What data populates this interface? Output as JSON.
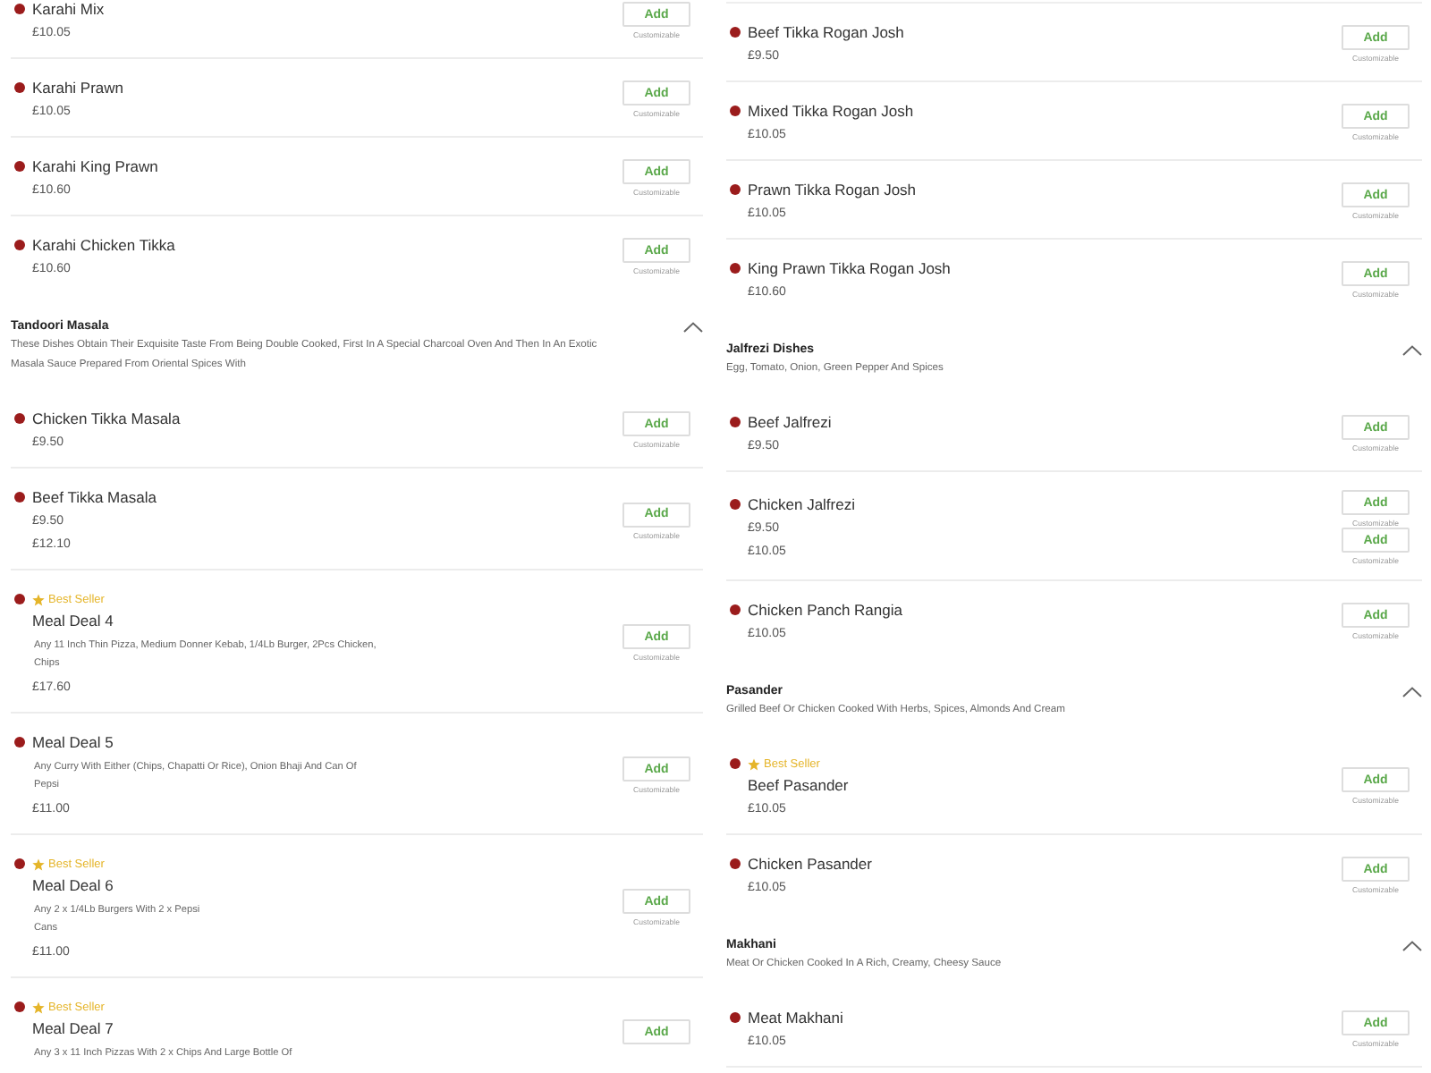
{
  "columns": [
    {
      "entries": [
        {
          "kind": "item",
          "name": "Karahi Mix",
          "prices": [
            "£10.05"
          ],
          "buttons": [
            {
              "label": "Add",
              "note": "Customizable"
            }
          ]
        },
        {
          "kind": "item",
          "name": "Karahi Prawn",
          "prices": [
            "£10.05"
          ],
          "buttons": [
            {
              "label": "Add",
              "note": "Customizable"
            }
          ]
        },
        {
          "kind": "item",
          "name": "Karahi King Prawn",
          "prices": [
            "£10.60"
          ],
          "buttons": [
            {
              "label": "Add",
              "note": "Customizable"
            }
          ]
        },
        {
          "kind": "item",
          "name": "Karahi Chicken Tikka",
          "prices": [
            "£10.60"
          ],
          "buttons": [
            {
              "label": "Add",
              "note": "Customizable"
            }
          ]
        },
        {
          "kind": "section",
          "title": "Tandoori Masala",
          "description": [
            "These Dishes Obtain Their Exquisite Taste From Being Double Cooked, First In A Special Charcoal Oven And Then In An Exotic",
            "Masala Sauce Prepared From Oriental Spices With"
          ],
          "expanded": true
        },
        {
          "kind": "item",
          "name": "Chicken Tikka Masala",
          "prices": [
            "£9.50"
          ],
          "buttons": [
            {
              "label": "Add",
              "note": "Customizable"
            }
          ]
        },
        {
          "kind": "item",
          "name": "Beef Tikka Masala",
          "prices": [
            "£9.50",
            "£12.10"
          ],
          "buttons": [
            {
              "label": "Add",
              "note": "Customizable"
            }
          ]
        },
        {
          "kind": "item",
          "badge": "Best Seller",
          "name": "Meal Deal 4",
          "description": [
            "Any 11 Inch Thin Pizza, Medium Donner Kebab, 1/4Lb Burger, 2Pcs Chicken,",
            "Chips"
          ],
          "prices": [
            "£17.60"
          ],
          "buttons": [
            {
              "label": "Add",
              "note": "Customizable"
            }
          ]
        },
        {
          "kind": "item",
          "name": "Meal Deal 5",
          "description": [
            "Any Curry With Either (Chips, Chapatti Or Rice), Onion Bhaji And Can Of",
            "Pepsi"
          ],
          "prices": [
            "£11.00"
          ],
          "buttons": [
            {
              "label": "Add",
              "note": "Customizable"
            }
          ]
        },
        {
          "kind": "item",
          "badge": "Best Seller",
          "name": "Meal Deal 6",
          "description": [
            "Any 2 x 1/4Lb Burgers With 2 x Pepsi",
            "Cans"
          ],
          "prices": [
            "£11.00"
          ],
          "buttons": [
            {
              "label": "Add",
              "note": "Customizable"
            }
          ]
        },
        {
          "kind": "item",
          "badge": "Best Seller",
          "name": "Meal Deal 7",
          "description": [
            "Any 3 x 11 Inch Pizzas With 2 x Chips And Large Bottle Of"
          ],
          "buttons": [
            {
              "label": "Add"
            }
          ]
        }
      ]
    },
    {
      "entries": [
        {
          "kind": "item",
          "name": "Beef Tikka Rogan Josh",
          "prices": [
            "£9.50"
          ],
          "buttons": [
            {
              "label": "Add",
              "note": "Customizable"
            }
          ]
        },
        {
          "kind": "item",
          "name": "Mixed Tikka Rogan Josh",
          "prices": [
            "£10.05"
          ],
          "buttons": [
            {
              "label": "Add",
              "note": "Customizable"
            }
          ]
        },
        {
          "kind": "item",
          "name": "Prawn Tikka Rogan Josh",
          "prices": [
            "£10.05"
          ],
          "buttons": [
            {
              "label": "Add",
              "note": "Customizable"
            }
          ]
        },
        {
          "kind": "item",
          "name": "King Prawn Tikka Rogan Josh",
          "prices": [
            "£10.60"
          ],
          "buttons": [
            {
              "label": "Add",
              "note": "Customizable"
            }
          ]
        },
        {
          "kind": "section",
          "title": "Jalfrezi Dishes",
          "description": [
            "Egg, Tomato, Onion, Green Pepper And Spices"
          ],
          "expanded": true
        },
        {
          "kind": "item",
          "name": "Beef Jalfrezi",
          "prices": [
            "£9.50"
          ],
          "buttons": [
            {
              "label": "Add",
              "note": "Customizable"
            }
          ]
        },
        {
          "kind": "item",
          "name": "Chicken Jalfrezi",
          "prices": [
            "£9.50",
            "£10.05"
          ],
          "buttons": [
            {
              "label": "Add",
              "note": "Customizable"
            },
            {
              "label": "Add",
              "note": "Customizable"
            }
          ]
        },
        {
          "kind": "item",
          "name": "Chicken Panch Rangia",
          "prices": [
            "£10.05"
          ],
          "buttons": [
            {
              "label": "Add",
              "note": "Customizable"
            }
          ]
        },
        {
          "kind": "section",
          "title": "Pasander",
          "description": [
            "Grilled Beef Or Chicken Cooked With Herbs, Spices, Almonds And Cream"
          ],
          "expanded": true
        },
        {
          "kind": "item",
          "badge": "Best Seller",
          "name": "Beef Pasander",
          "prices": [
            "£10.05"
          ],
          "buttons": [
            {
              "label": "Add",
              "note": "Customizable"
            }
          ]
        },
        {
          "kind": "item",
          "name": "Chicken Pasander",
          "prices": [
            "£10.05"
          ],
          "buttons": [
            {
              "label": "Add",
              "note": "Customizable"
            }
          ]
        },
        {
          "kind": "section",
          "title": "Makhani",
          "description": [
            "Meat Or Chicken Cooked In A Rich, Creamy, Cheesy Sauce"
          ],
          "expanded": true
        },
        {
          "kind": "item",
          "name": "Meat Makhani",
          "prices": [
            "£10.05"
          ],
          "buttons": [
            {
              "label": "Add",
              "note": "Customizable"
            }
          ]
        }
      ]
    }
  ]
}
